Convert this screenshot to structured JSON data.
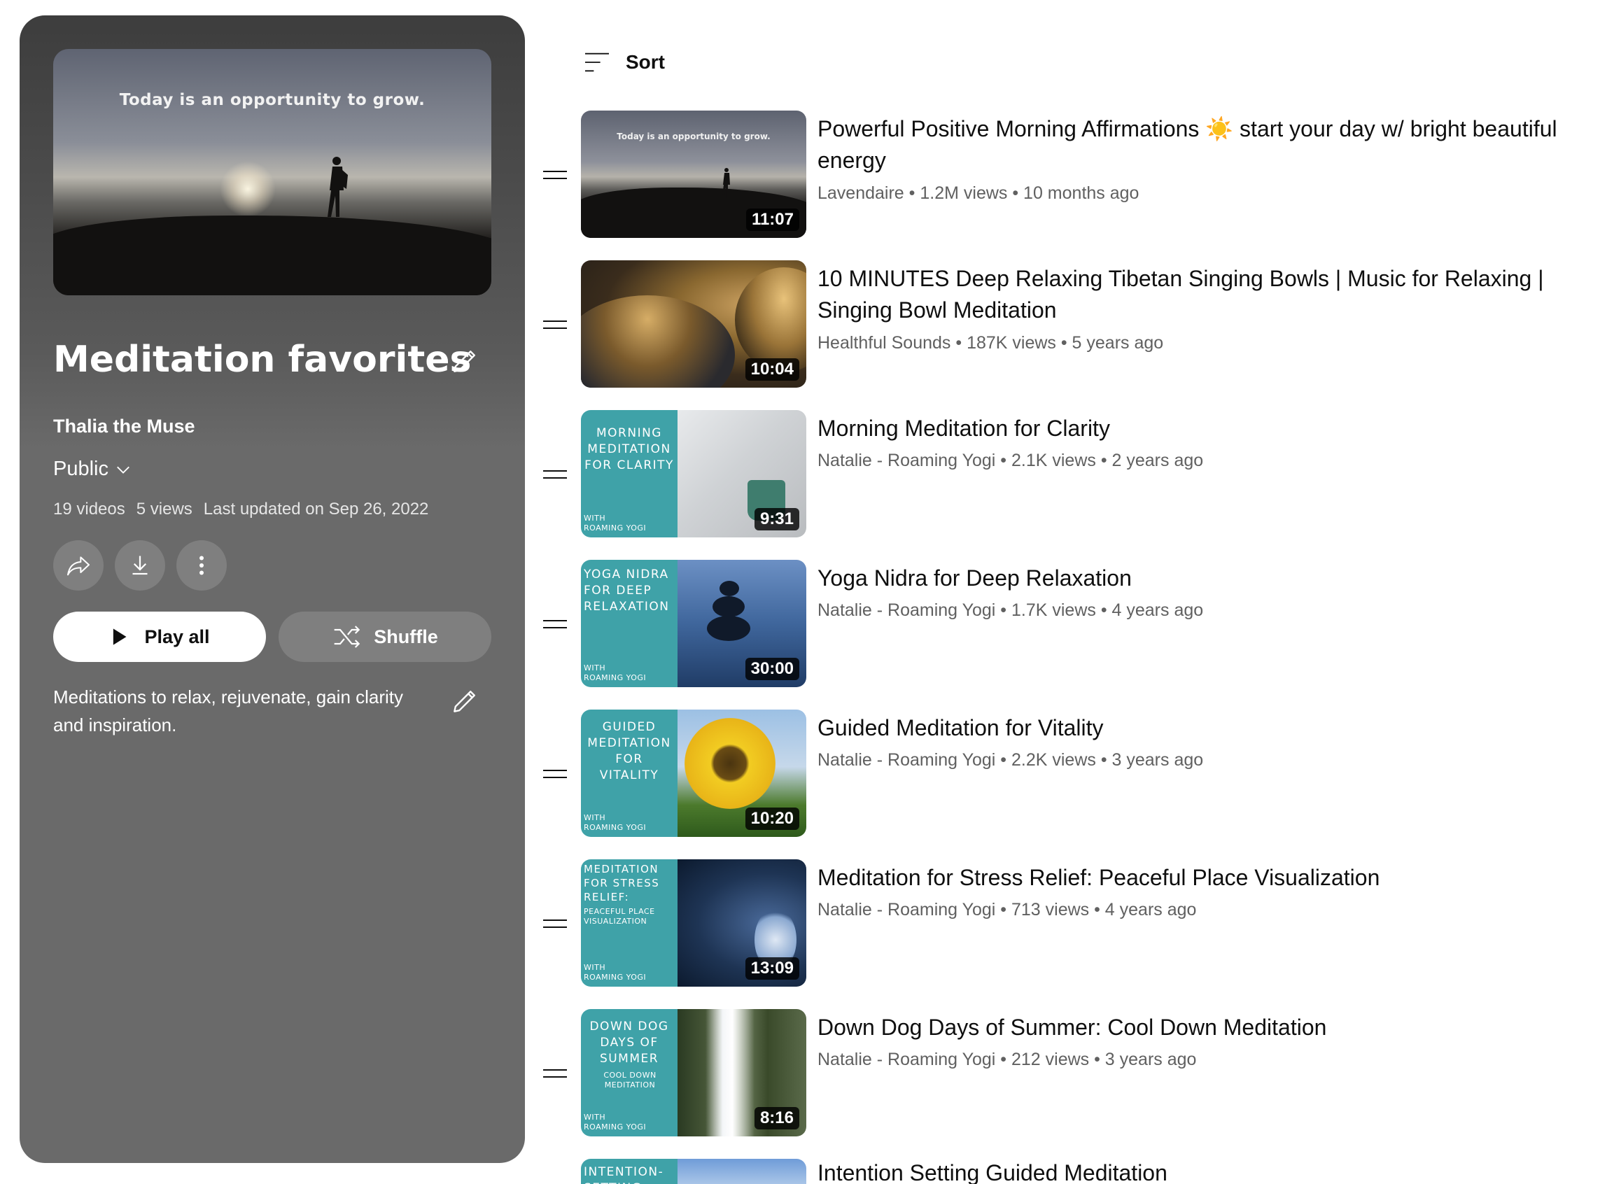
{
  "playlist": {
    "hero_quote": "Today is an opportunity to grow.",
    "title": "Meditation favorites",
    "owner": "Thalia the Muse",
    "privacy": "Public",
    "video_count": "19 videos",
    "view_count": "5 views",
    "last_updated": "Last updated on Sep 26, 2022",
    "play_all_label": "Play all",
    "shuffle_label": "Shuffle",
    "description": "Meditations to relax, rejuvenate, gain clarity and inspiration."
  },
  "sort_label": "Sort",
  "videos": [
    {
      "title": "Powerful Positive Morning Affirmations ☀️ start your day w/ bright beautiful energy",
      "channel": "Lavendaire",
      "stats": "1.2M views • 10 months ago",
      "duration": "11:07",
      "thumb_text": "Today is an opportunity to grow."
    },
    {
      "title": "10 MINUTES Deep Relaxing Tibetan Singing Bowls | Music for Relaxing | Singing Bowl Meditation",
      "channel": "Healthful Sounds",
      "stats": "187K views • 5 years ago",
      "duration": "10:04"
    },
    {
      "title": "Morning Meditation for Clarity",
      "channel": "Natalie - Roaming Yogi",
      "stats": "2.1K views • 2 years ago",
      "duration": "9:31",
      "thumb_text": "MORNING MEDITATION FOR CLARITY",
      "thumb_with": "WITH ROAMING YOGI"
    },
    {
      "title": "Yoga Nidra for Deep Relaxation",
      "channel": "Natalie - Roaming Yogi",
      "stats": "1.7K views • 4 years ago",
      "duration": "30:00",
      "thumb_text": "YOGA NIDRA FOR DEEP RELAXATION",
      "thumb_with": "WITH ROAMING YOGI"
    },
    {
      "title": "Guided Meditation for Vitality",
      "channel": "Natalie - Roaming Yogi",
      "stats": "2.2K views • 3 years ago",
      "duration": "10:20",
      "thumb_text": "GUIDED MEDITATION FOR VITALITY",
      "thumb_with": "WITH ROAMING YOGI"
    },
    {
      "title": "Meditation for Stress Relief: Peaceful Place Visualization",
      "channel": "Natalie - Roaming Yogi",
      "stats": "713 views • 4 years ago",
      "duration": "13:09",
      "thumb_text": "MEDITATION FOR STRESS RELIEF:",
      "thumb_sub": "PEACEFUL PLACE VISUALIZATION",
      "thumb_with": "WITH ROAMING YOGI"
    },
    {
      "title": "Down Dog Days of Summer: Cool Down Meditation",
      "channel": "Natalie - Roaming Yogi",
      "stats": "212 views • 3 years ago",
      "duration": "8:16",
      "thumb_text": "DOWN DOG DAYS OF SUMMER",
      "thumb_sub": "COOL DOWN MEDITATION",
      "thumb_with": "WITH ROAMING YOGI"
    },
    {
      "title": "Intention Setting Guided Meditation",
      "thumb_text": "INTENTION- SETTING"
    }
  ],
  "colors": {
    "panel_bg": "#6a6a6a",
    "thumb_teal": "#3fa2a8",
    "meta_text": "#606060"
  },
  "icons": {
    "edit": "pencil-icon",
    "privacy_dropdown": "chevron-down-icon",
    "share": "share-icon",
    "download": "download-icon",
    "more": "more-vertical-icon",
    "play": "play-icon",
    "shuffle": "shuffle-icon",
    "sort": "sort-icon",
    "drag": "drag-handle-icon"
  }
}
